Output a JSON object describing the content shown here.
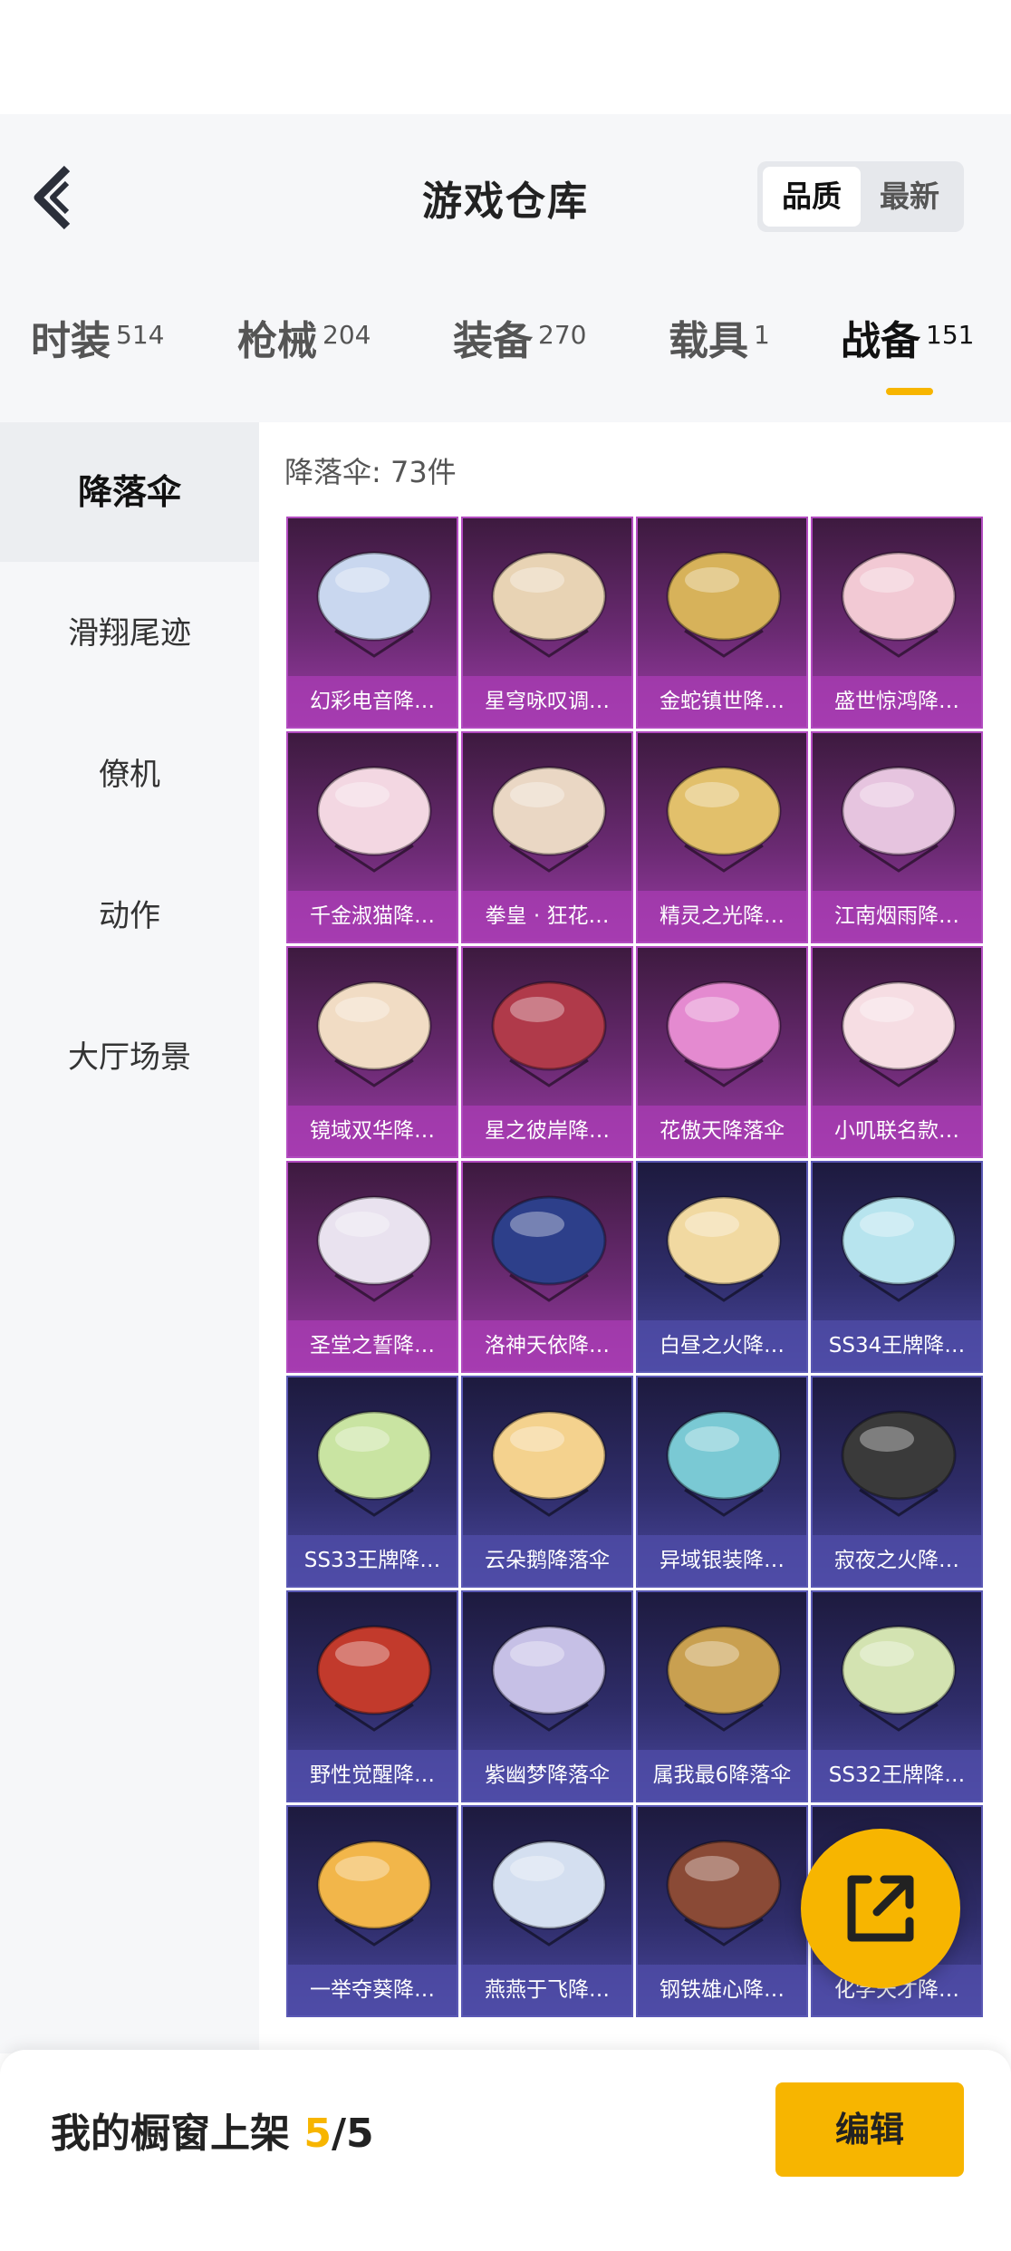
{
  "header": {
    "title": "游戏仓库",
    "sort_options": [
      "品质",
      "最新"
    ]
  },
  "tabs": [
    {
      "label": "时装",
      "count": "514"
    },
    {
      "label": "枪械",
      "count": "204"
    },
    {
      "label": "装备",
      "count": "270"
    },
    {
      "label": "载具",
      "count": "1"
    },
    {
      "label": "战备",
      "count": "151"
    }
  ],
  "categories": [
    "降落伞",
    "滑翔尾迹",
    "僚机",
    "动作",
    "大厅场景"
  ],
  "content": {
    "count_label": "降落伞: 73件"
  },
  "items": [
    {
      "name": "幻彩电音降…",
      "rarity": "purple",
      "color": "#c9d7ef"
    },
    {
      "name": "星穹咏叹调…",
      "rarity": "purple",
      "color": "#e8d3b4"
    },
    {
      "name": "金蛇镇世降…",
      "rarity": "purple",
      "color": "#d7b25a"
    },
    {
      "name": "盛世惊鸿降…",
      "rarity": "purple",
      "color": "#f2c9d4"
    },
    {
      "name": "千金淑猫降…",
      "rarity": "purple",
      "color": "#f3d7e2"
    },
    {
      "name": "拳皇 · 狂花…",
      "rarity": "purple",
      "color": "#ead7c4"
    },
    {
      "name": "精灵之光降…",
      "rarity": "purple",
      "color": "#e2c06b"
    },
    {
      "name": "江南烟雨降…",
      "rarity": "purple",
      "color": "#e6c4df"
    },
    {
      "name": "镜域双华降…",
      "rarity": "purple",
      "color": "#f1dcc4"
    },
    {
      "name": "星之彼岸降…",
      "rarity": "purple",
      "color": "#b03a4a"
    },
    {
      "name": "花傲天降落伞",
      "rarity": "purple",
      "color": "#e48ad0"
    },
    {
      "name": "小叽联名款…",
      "rarity": "purple",
      "color": "#f6dde3"
    },
    {
      "name": "圣堂之誓降…",
      "rarity": "purple",
      "color": "#e9e2ef"
    },
    {
      "name": "洛神天依降…",
      "rarity": "purple",
      "color": "#2d3f8a"
    },
    {
      "name": "白昼之火降…",
      "rarity": "blue",
      "color": "#f1d9a1"
    },
    {
      "name": "SS34王牌降…",
      "rarity": "blue",
      "color": "#b7e4ee"
    },
    {
      "name": "SS33王牌降…",
      "rarity": "blue",
      "color": "#c9e4a2"
    },
    {
      "name": "云朵鹅降落伞",
      "rarity": "blue",
      "color": "#f4d28e"
    },
    {
      "name": "异域银装降…",
      "rarity": "blue",
      "color": "#7ac9d4"
    },
    {
      "name": "寂夜之火降…",
      "rarity": "blue",
      "color": "#3a3a3a"
    },
    {
      "name": "野性觉醒降…",
      "rarity": "blue",
      "color": "#c23a2c"
    },
    {
      "name": "紫幽梦降落伞",
      "rarity": "blue",
      "color": "#c6c0e6"
    },
    {
      "name": "属我最6降落伞",
      "rarity": "blue",
      "color": "#c9a050"
    },
    {
      "name": "SS32王牌降…",
      "rarity": "blue",
      "color": "#d3e3b1"
    },
    {
      "name": "一举夺葵降…",
      "rarity": "blue",
      "color": "#f2b64a"
    },
    {
      "name": "燕燕于飞降…",
      "rarity": "blue",
      "color": "#d4dff0"
    },
    {
      "name": "钢铁雄心降…",
      "rarity": "blue",
      "color": "#8a4a36"
    },
    {
      "name": "化学天才降…",
      "rarity": "blue",
      "color": "#9fd6e4"
    }
  ],
  "bottom": {
    "showcase_text": "我的橱窗上架",
    "showcase_current": "5",
    "showcase_total": "/5",
    "edit_label": "编辑"
  },
  "colors": {
    "accent": "#f7b500",
    "purple_rarity": "#9b3ca6",
    "blue_rarity": "#4a48a0"
  },
  "icons": {
    "back": "chevron-left-icon",
    "fab": "share-external-icon"
  }
}
